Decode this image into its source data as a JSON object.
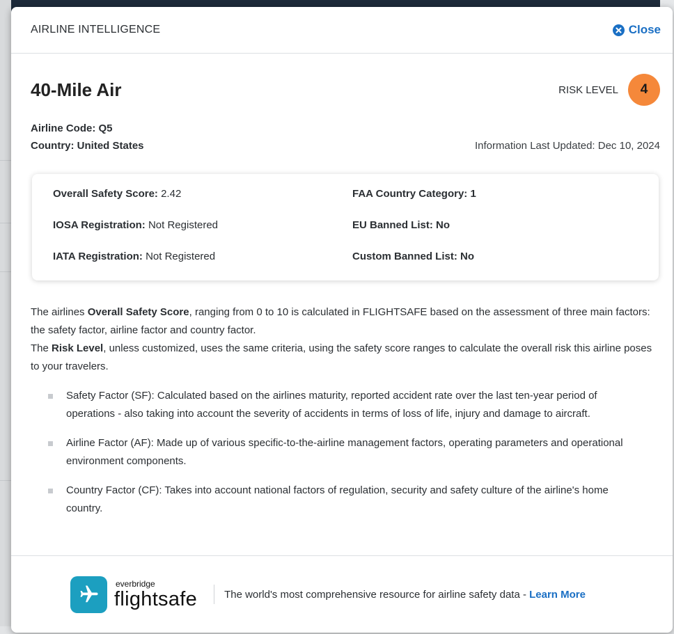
{
  "modal": {
    "header_title": "AIRLINE INTELLIGENCE",
    "close_label": "Close"
  },
  "airline": {
    "name": "40-Mile Air",
    "risk_label": "RISK LEVEL",
    "risk_value": "4",
    "code_label": "Airline Code:",
    "code_value": "Q5",
    "country_label": "Country:",
    "country_value": "United States",
    "updated": "Information Last Updated: Dec 10, 2024"
  },
  "card": {
    "items": [
      {
        "label": "Overall Safety Score:",
        "value": "2.42"
      },
      {
        "label": "FAA Country Category:",
        "value": "1"
      },
      {
        "label": "IOSA Registration:",
        "value": "Not Registered"
      },
      {
        "label": "EU Banned List:",
        "value": "No"
      },
      {
        "label": "IATA Registration:",
        "value": "Not Registered"
      },
      {
        "label": "Custom Banned List:",
        "value": "No"
      }
    ]
  },
  "description": {
    "p1_a": "The airlines ",
    "p1_bold": "Overall Safety Score",
    "p1_b": ", ranging from 0 to 10 is calculated in FLIGHTSAFE based on the assessment of three main factors: the safety factor, airline factor and country factor.",
    "p2_a": "The ",
    "p2_bold": "Risk Level",
    "p2_b": ", unless customized, uses the same criteria, using the safety score ranges to calculate the overall risk this airline poses to your travelers."
  },
  "bullets": [
    "Safety Factor (SF): Calculated based on the airlines maturity, reported accident rate over the last ten-year period of operations - also taking into account the severity of accidents in terms of loss of life, injury and damage to aircraft.",
    "Airline Factor (AF): Made up of various specific-to-the-airline management factors, operating parameters and operational environment components.",
    "Country Factor (CF): Takes into account national factors of regulation, security and safety culture of the airline's home country."
  ],
  "footer": {
    "logo_top": "everbridge",
    "logo_main": "flightsafe",
    "text": "The world's most comprehensive resource for airline safety data - ",
    "link": "Learn More"
  },
  "colors": {
    "accent": "#1a6fc4",
    "risk_badge": "#f5883a",
    "logo": "#1c9fc0"
  },
  "icons": [
    "close-icon",
    "airplane-icon"
  ]
}
